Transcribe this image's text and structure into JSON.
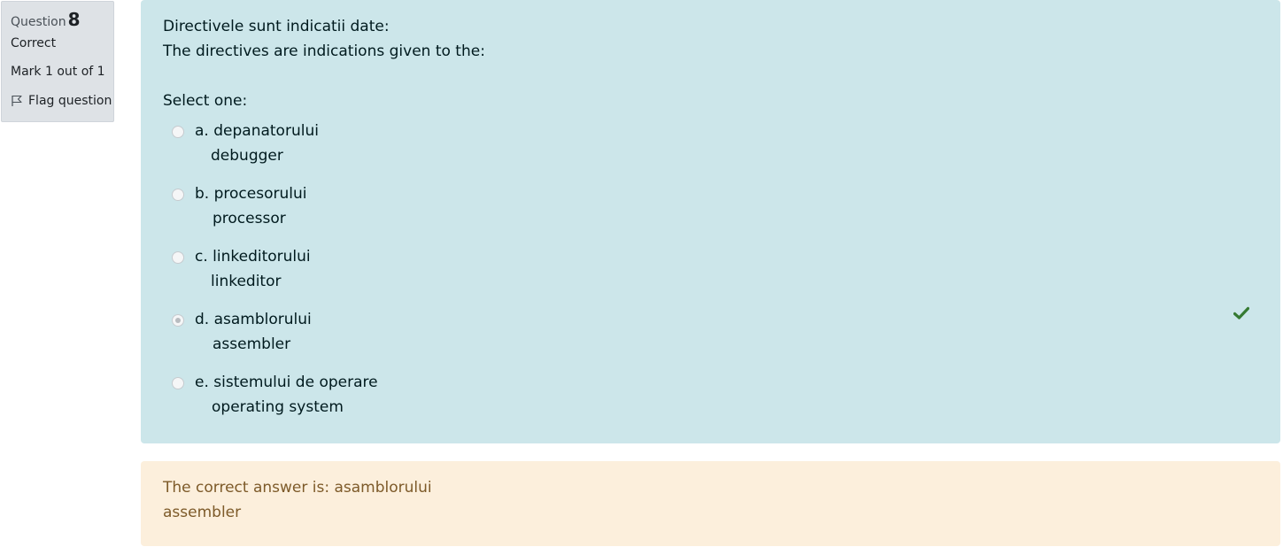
{
  "info": {
    "question_label": "Question",
    "question_number": "8",
    "state": "Correct",
    "grade": "Mark 1 out of 1",
    "flag_label": "Flag question"
  },
  "question": {
    "line_ro": "Directivele sunt indicatii date:",
    "line_en": "The directives are indications given to the:",
    "prompt": "Select one:",
    "options": [
      {
        "prefix": "a.",
        "text_ro": "depanatorului",
        "text_en": "debugger",
        "checked": false
      },
      {
        "prefix": "b.",
        "text_ro": "procesorului",
        "text_en": "processor",
        "checked": false
      },
      {
        "prefix": "c.",
        "text_ro": "linkeditorului",
        "text_en": "linkeditor",
        "checked": false
      },
      {
        "prefix": "d.",
        "text_ro": "asamblorului",
        "text_en": "assembler",
        "checked": true
      },
      {
        "prefix": "e.",
        "text_ro": "sistemului de operare",
        "text_en": "operating system",
        "checked": false
      }
    ]
  },
  "feedback": {
    "line1": "The correct answer is: asamblorului",
    "line2": "assembler"
  },
  "colors": {
    "formulation_bg": "#cce6ea",
    "outcome_bg": "#fcefdc",
    "correct_check": "#357a32"
  },
  "icons": {
    "flag": "flag-icon",
    "correct": "check-icon"
  }
}
